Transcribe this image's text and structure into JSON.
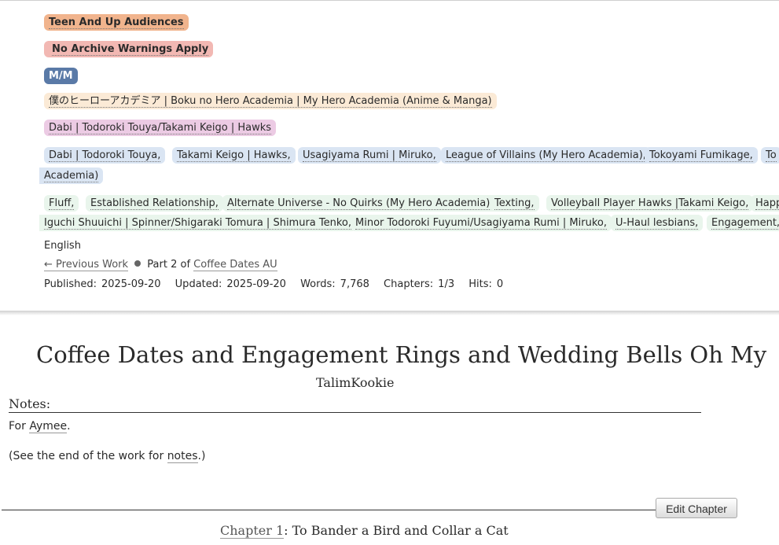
{
  "meta": {
    "rating": "Teen And Up Audiences",
    "warning": "No Archive Warnings Apply",
    "category": "M/M",
    "fandom": "僕のヒーローアカデミア | Boku no Hero Academia | My Hero Academia (Anime & Manga)",
    "relationship": "Dabi | Todoroki Touya/Takami Keigo | Hawks",
    "characters": [
      "Dabi | Todoroki Touya,",
      "Takami Keigo | Hawks,",
      "Usagiyama Rumi | Miruko,",
      "League of Villains (My Hero Academia),",
      "Tokoyami Fumikage,",
      "To"
    ],
    "characters_wrap": "Academia)",
    "freeforms_line1": [
      "Fluff,",
      "Established Relationship,",
      "Alternate Universe - No Quirks (My Hero Academia),",
      "Texting,",
      "Volleyball Player Hawks |Takami Keigo,",
      "Happ"
    ],
    "freeforms_line2": [
      "Iguchi Shuuichi | Spinner/Shigaraki Tomura | Shimura Tenko,",
      "Minor Todoroki Fuyumi/Usagiyama Rumi | Miruko,",
      "U-Haul lesbians,",
      "Engagement,"
    ],
    "language": "English",
    "series": {
      "prev": "← Previous Work",
      "part": "Part 2 of",
      "name": "Coffee Dates AU"
    },
    "stats": {
      "published_label": "Published:",
      "published": "2025-09-20",
      "updated_label": "Updated:",
      "updated": "2025-09-20",
      "words_label": "Words:",
      "words": "7,768",
      "chapters_label": "Chapters:",
      "chapters": "1/3",
      "hits_label": "Hits:",
      "hits": "0"
    }
  },
  "work": {
    "title": "Coffee Dates and Engagement Rings and Wedding Bells Oh My",
    "author": "TalimKookie"
  },
  "notes": {
    "heading": "Notes:",
    "for_prefix": "For",
    "for_name": "Aymee",
    "for_suffix": ".",
    "see_prefix": "(See the end of the work for",
    "see_link": "notes",
    "see_suffix": ".)"
  },
  "chapter": {
    "edit_label": "Edit Chapter",
    "link": "Chapter 1",
    "title": ": To Bander a Bird and Collar a Cat"
  }
}
